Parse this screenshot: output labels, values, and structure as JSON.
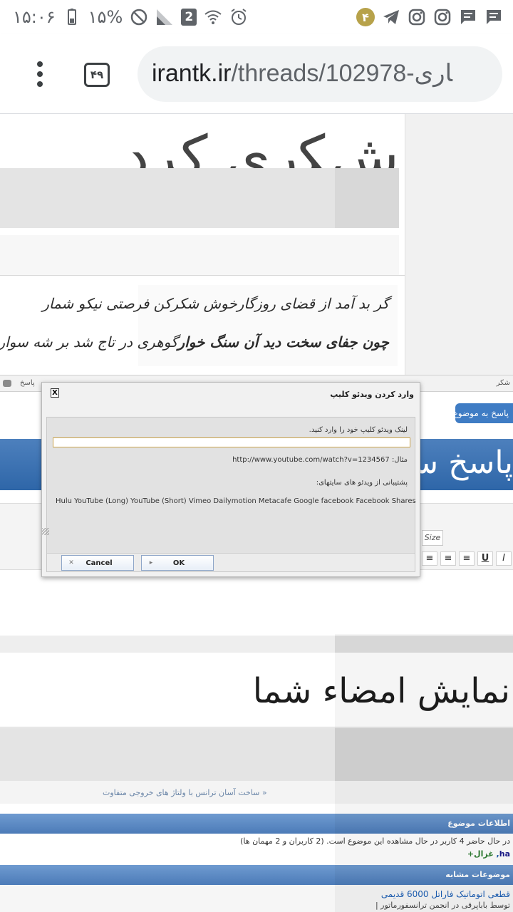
{
  "status": {
    "time": "۱۵:۰۶",
    "battery": "۱۵%",
    "sim": "2",
    "notif_count": "۴"
  },
  "browser": {
    "tab_count": "۴۹",
    "url_host": "irantk.ir",
    "url_path": "/threads/102978-ﺎﺭی"
  },
  "page": {
    "top_heading": "ﺵﮑﺭی کرﺩﻡ",
    "poem": {
      "line1_right": "گر بد آمد از قضای روزگار",
      "line1_left": "خوش شکرکن فرصتی نیکو شمار",
      "line2_right": "چون جفای سخت دید آن سنگ خوار",
      "line2_left": "گوهری در تاج شد بر شه سوار"
    },
    "reply_left": "پاسخ",
    "reply_right": "شکر",
    "reply_topic": "پاسخ به موضوع",
    "big_reply": "پاسخ سریع",
    "size_label": "Size",
    "signature_heading": "نمایش امضاء شما",
    "prev_thread": "« ساخت آسان ترانس با ولتاژ های خروجی متفاوت",
    "info_title": "اطلاعات موضوع",
    "viewers_text": "در حال حاضر 4 کاربر در حال مشاهده این موضوع است. (2 کاربران و 2 مهمان ها)",
    "viewer_a": "غزال+",
    "viewer_b": "ha",
    "similar_title": "موضوعات مشابه",
    "similar_link": "قطعی اتوماتیک فاراتل 6000 قدیمی",
    "similar_sub": "توسط باباپرقی در انجمن ترانسفورماتور |"
  },
  "dialog": {
    "title": "وارد کردن ویدئو کلیپ",
    "close": "X",
    "prompt": "لینک ویدئو کلیپ خود را وارد کنید.",
    "input_value": "",
    "example_label": "مثال:",
    "example_url": "http://www.youtube.com/watch?v=1234567",
    "support_label": "پشتیبانی از ویدئو های سایتهای:",
    "sites": "Hulu YouTube (Long) YouTube (Short) Vimeo Dailymotion Metacafe Google facebook Facebook Shares",
    "cancel": "Cancel",
    "ok": "OK"
  }
}
